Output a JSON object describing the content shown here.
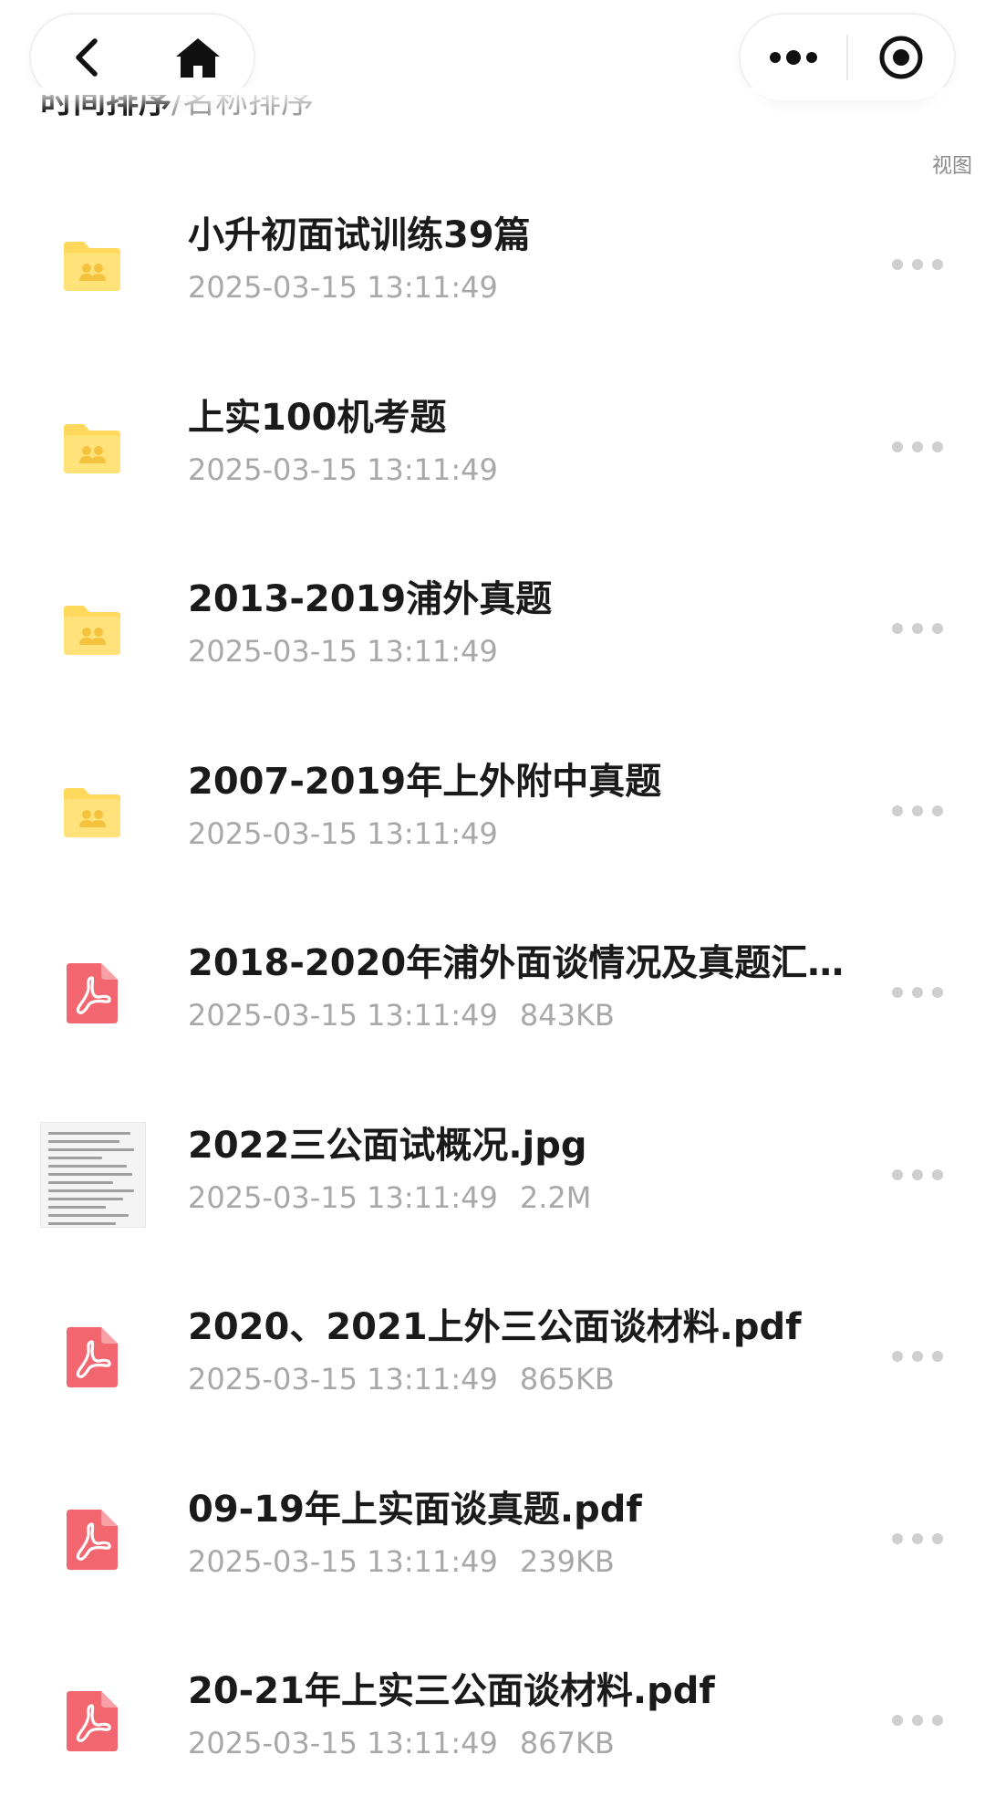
{
  "nav": {
    "back_icon": "chevron-left-icon",
    "home_icon": "home-icon",
    "more_icon": "more-dots-icon",
    "close_icon": "capsule-close-icon"
  },
  "sort": {
    "active_label": "时间排序",
    "separator": "/",
    "inactive_label": "名称排序"
  },
  "view_label": "视图",
  "colors": {
    "folder": "#FFD85C",
    "pdf": "#F2666F",
    "meta_text": "#A8A8A8",
    "more_dots": "#CFCFCF"
  },
  "files": [
    {
      "type": "folder",
      "icon": "folder-icon",
      "name": "小升初面试训练39篇",
      "date": "2025-03-15 13:11:49",
      "size": ""
    },
    {
      "type": "folder",
      "icon": "folder-icon",
      "name": "上实100机考题",
      "date": "2025-03-15 13:11:49",
      "size": ""
    },
    {
      "type": "folder",
      "icon": "folder-icon",
      "name": "2013-2019浦外真题",
      "date": "2025-03-15 13:11:49",
      "size": ""
    },
    {
      "type": "folder",
      "icon": "folder-icon",
      "name": "2007-2019年上外附中真题",
      "date": "2025-03-15 13:11:49",
      "size": ""
    },
    {
      "type": "pdf",
      "icon": "pdf-icon",
      "name": "2018-2020年浦外面谈情况及真题汇...",
      "date": "2025-03-15 13:11:49",
      "size": "843KB"
    },
    {
      "type": "image",
      "icon": "image-thumbnail",
      "name": "2022三公面试概况.jpg",
      "date": "2025-03-15 13:11:49",
      "size": "2.2M"
    },
    {
      "type": "pdf",
      "icon": "pdf-icon",
      "name": "2020、2021上外三公面谈材料.pdf",
      "date": "2025-03-15 13:11:49",
      "size": "865KB"
    },
    {
      "type": "pdf",
      "icon": "pdf-icon",
      "name": "09-19年上实面谈真题.pdf",
      "date": "2025-03-15 13:11:49",
      "size": "239KB"
    },
    {
      "type": "pdf",
      "icon": "pdf-icon",
      "name": "20-21年上实三公面谈材料.pdf",
      "date": "2025-03-15 13:11:49",
      "size": "867KB"
    }
  ]
}
